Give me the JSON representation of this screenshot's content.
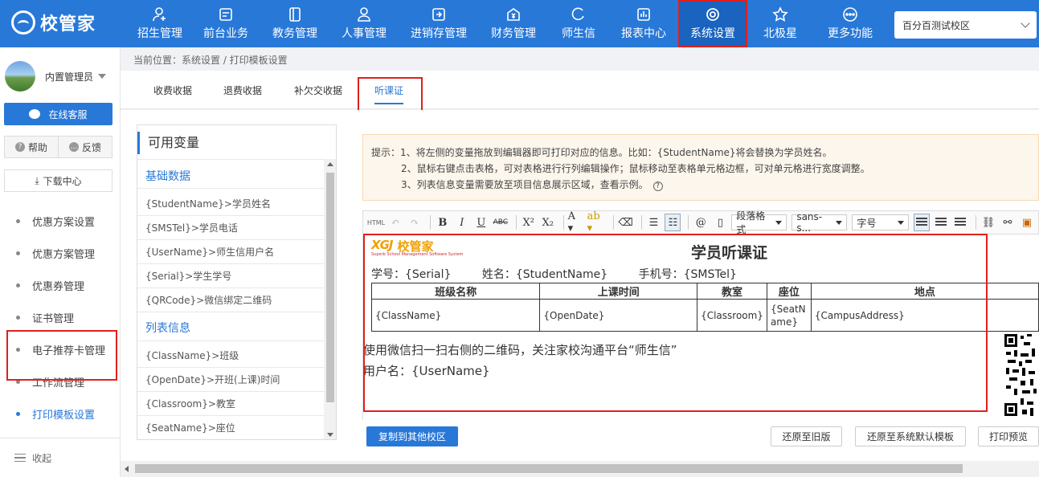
{
  "app": {
    "logo_text": "校管家"
  },
  "nav": {
    "items": [
      {
        "label": "招生管理",
        "icon": "person-add-icon"
      },
      {
        "label": "前台业务",
        "icon": "desk-icon"
      },
      {
        "label": "教务管理",
        "icon": "book-icon"
      },
      {
        "label": "人事管理",
        "icon": "person-icon"
      },
      {
        "label": "进销存管理",
        "icon": "inventory-icon"
      },
      {
        "label": "财务管理",
        "icon": "finance-icon"
      },
      {
        "label": "师生信",
        "icon": "chat-icon"
      },
      {
        "label": "报表中心",
        "icon": "report-icon"
      },
      {
        "label": "系统设置",
        "icon": "settings-icon"
      },
      {
        "label": "北极星",
        "icon": "star-icon"
      },
      {
        "label": "更多功能",
        "icon": "more-icon"
      }
    ],
    "active": "系统设置",
    "campus": "百分百测试校区"
  },
  "sidebar": {
    "user_name": "内置管理员",
    "service_label": "在线客服",
    "help_label": "帮助",
    "feedback_label": "反馈",
    "download_label": "下载中心",
    "menu": [
      {
        "label": "优惠方案设置"
      },
      {
        "label": "优惠方案管理"
      },
      {
        "label": "优惠券管理"
      },
      {
        "label": "证书管理"
      },
      {
        "label": "电子推荐卡管理"
      },
      {
        "label": "工作流管理"
      },
      {
        "label": "打印模板设置"
      }
    ],
    "active_menu": "打印模板设置",
    "collapse_label": "收起"
  },
  "breadcrumb": "当前位置：系统设置 / 打印模板设置",
  "tabs": [
    {
      "label": "收费收据"
    },
    {
      "label": "退费收据"
    },
    {
      "label": "补欠交收据"
    },
    {
      "label": "听课证"
    }
  ],
  "active_tab": "听课证",
  "variables": {
    "title": "可用变量",
    "groups": [
      {
        "name": "基础数据",
        "items": [
          "{StudentName}>学员姓名",
          "{SMSTel}>学员电话",
          "{UserName}>师生信用户名",
          "{Serial}>学生学号",
          "{QRCode}>微信绑定二维码"
        ]
      },
      {
        "name": "列表信息",
        "items": [
          "{ClassName}>班级",
          "{OpenDate}>开班(上课)时间",
          "{Classroom}>教室",
          "{SeatName}>座位"
        ]
      }
    ]
  },
  "tips": {
    "line1": "提示：1、将左侧的变量拖放到编辑器即可打印对应的信息。比如：{StudentName}将会替换为学员姓名。",
    "line2": "2、鼠标右键点击表格，可对表格进行行列编辑操作；鼠标移动至表格单元格边框，可对单元格进行宽度调整。",
    "line3": "3、列表信息变量需要放至项目信息展示区域，查看示例。"
  },
  "toolbar": {
    "html": "HTML",
    "paragraph": "段落格式",
    "font": "sans-s...",
    "size": "字号"
  },
  "document": {
    "brand_logo": "XGJ",
    "brand_name": "校管家",
    "brand_sub": "Superb School Management Software System",
    "title": "学员听课证",
    "info": [
      "学号：{Serial}",
      "姓名：{StudentName}",
      "手机号：{SMSTel}"
    ],
    "table": {
      "headers": [
        "班级名称",
        "上课时间",
        "教室",
        "座位",
        "地点"
      ],
      "row": [
        "{ClassName}",
        "{OpenDate}",
        "{Classroom}",
        "{SeatName}",
        "{CampusAddress}"
      ]
    },
    "line1": "使用微信扫一扫右侧的二维码，关注家校沟通平台“师生信”",
    "line2": "用户名：{UserName}"
  },
  "buttons": {
    "copy": "复制到其他校区",
    "restore_old": "还原至旧版",
    "restore_default": "还原至系统默认模板",
    "print_preview": "打印预览"
  },
  "colors": {
    "primary": "#2878d8",
    "highlight": "#e0201c"
  }
}
